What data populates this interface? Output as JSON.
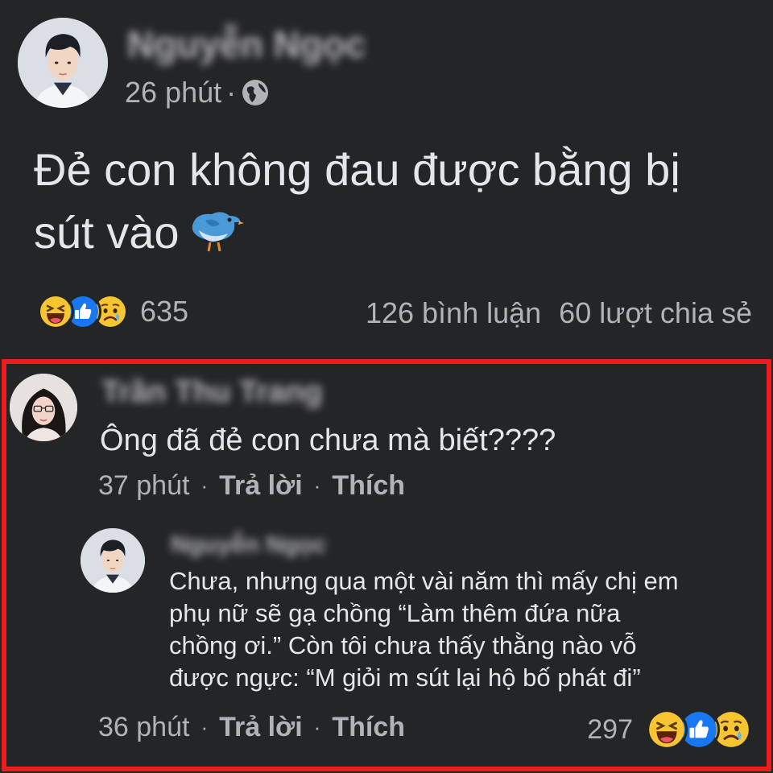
{
  "post": {
    "author": "Nguyễn Ngọc",
    "time": "26 phút",
    "separator": "·",
    "privacy_icon": "globe-icon",
    "text": "Đẻ con không đau được bằng bị sút vào",
    "emoji": "bird-icon",
    "reactions": [
      "haha-icon",
      "like-icon",
      "sad-icon"
    ],
    "reaction_count": "635",
    "comment_count": "126 bình luận",
    "share_count": "60 lượt chia sẻ"
  },
  "comment": {
    "author": "Trần Thu Trang",
    "text": "Ông đã đẻ con chưa mà biết????",
    "time": "37 phút",
    "reply_label": "Trả lời",
    "like_label": "Thích",
    "separator": "·"
  },
  "reply": {
    "author": "Nguyễn Ngọc",
    "text_lines": [
      "Chưa, nhưng qua một vài năm thì mấy chị em",
      "phụ nữ sẽ gạ chồng “Làm thêm đứa nữa",
      "chồng ơi.” Còn tôi chưa thấy thằng nào vỗ",
      "được ngực: “M giỏi m sút lại hộ bố phát đi”"
    ],
    "time": "36 phút",
    "reply_label": "Trả lời",
    "like_label": "Thích",
    "separator": "·",
    "reaction_count": "297",
    "reactions": [
      "haha-icon",
      "like-icon",
      "sad-icon"
    ]
  },
  "colors": {
    "background": "#242526",
    "text": "#e4e6eb",
    "secondary": "#b0b3b8",
    "highlight_border": "#ee1c1c",
    "like_blue": "#1877f2",
    "emoji_yellow": "#f7c531"
  }
}
